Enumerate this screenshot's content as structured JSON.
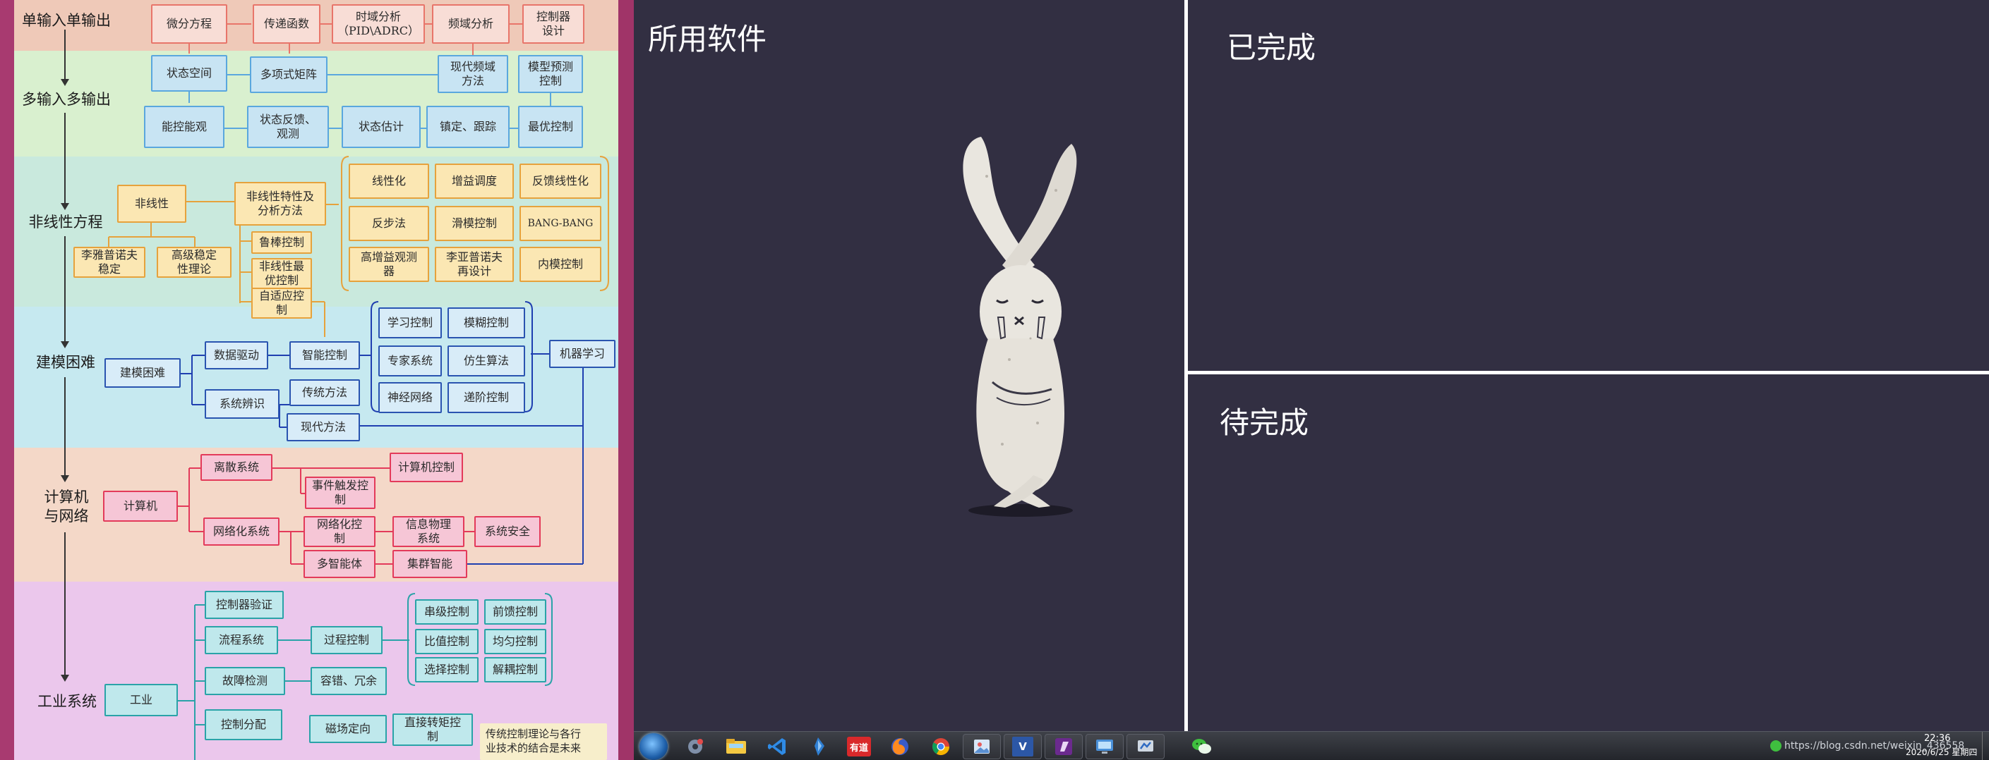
{
  "mindmap": {
    "bands": [
      {
        "title": "单输入单输出",
        "color": "#efc9b8"
      },
      {
        "title": "多输入多输出",
        "color": "#d9f0cf"
      },
      {
        "title": "非线性方程",
        "color": "#c9e9dd"
      },
      {
        "title": "建模困难",
        "color": "#c6e9f0"
      },
      {
        "title": "计算机\n与网络",
        "color": "#f4d8c8"
      },
      {
        "title": "工业系统",
        "color": "#ebc7ec"
      }
    ],
    "siso": [
      "微分方程",
      "传递函数",
      "时域分析\n（PID\\ADRC）",
      "频域分析",
      "控制器\n设计"
    ],
    "mimo_row1": [
      "状态空间",
      "多项式矩阵",
      "现代频域\n方法",
      "模型预测\n控制"
    ],
    "mimo_row2": [
      "能控能观",
      "状态反馈、\n观测",
      "状态估计",
      "镇定、跟踪",
      "最优控制"
    ],
    "nonlinear_left": [
      "非线性",
      "非线性特性及\n分析方法",
      "李雅普诺夫\n稳定",
      "高级稳定\n性理论",
      "鲁棒控制",
      "非线性最\n优控制",
      "自适应控\n制"
    ],
    "nonlinear_grid": [
      "线性化",
      "增益调度",
      "反馈线性化",
      "反步法",
      "滑模控制",
      "BANG-BANG",
      "高增益观测\n器",
      "李亚普诺夫\n再设计",
      "内模控制"
    ],
    "modeling": [
      "建模困难",
      "数据驱动",
      "智能控制",
      "系统辨识",
      "传统方法",
      "现代方法",
      "机器学习"
    ],
    "modeling_grid": [
      "学习控制",
      "模糊控制",
      "专家系统",
      "仿生算法",
      "神经网络",
      "递阶控制"
    ],
    "network": [
      "计算机",
      "离散系统",
      "计算机控制",
      "事件触发控\n制",
      "网络化系统",
      "网络化控\n制",
      "信息物理\n系统",
      "系统安全",
      "多智能体",
      "集群智能"
    ],
    "industry": [
      "工业",
      "控制器验证",
      "流程系统",
      "过程控制",
      "故障检测",
      "容错、冗余",
      "控制分配",
      "磁场定向",
      "直接转矩控\n制"
    ],
    "industry_grid": [
      "串级控制",
      "前馈控制",
      "比值控制",
      "均匀控制",
      "选择控制",
      "解耦控制"
    ],
    "note": "传统控制理论与各行\n业技术的结合是未来"
  },
  "desktop": {
    "label_software": "所用软件",
    "label_done": "已完成",
    "label_todo": "待完成"
  },
  "taskbar": {
    "apps": [
      "start-orb",
      "settings-app",
      "file-explorer",
      "vscode",
      "sourcetree",
      "youdao-dict",
      "firefox",
      "chrome",
      "photo-viewer",
      "visio",
      "onenote",
      "remote-desktop",
      "control-panel",
      "wechat"
    ],
    "youdao_label": "有道",
    "url_text": "https://blog.csdn.net/weixin_436558",
    "time": "22:36",
    "date": "2020/6/25 星期四"
  },
  "colors": {
    "desktop_bg": "#322f42",
    "divider": "#ffffff"
  }
}
